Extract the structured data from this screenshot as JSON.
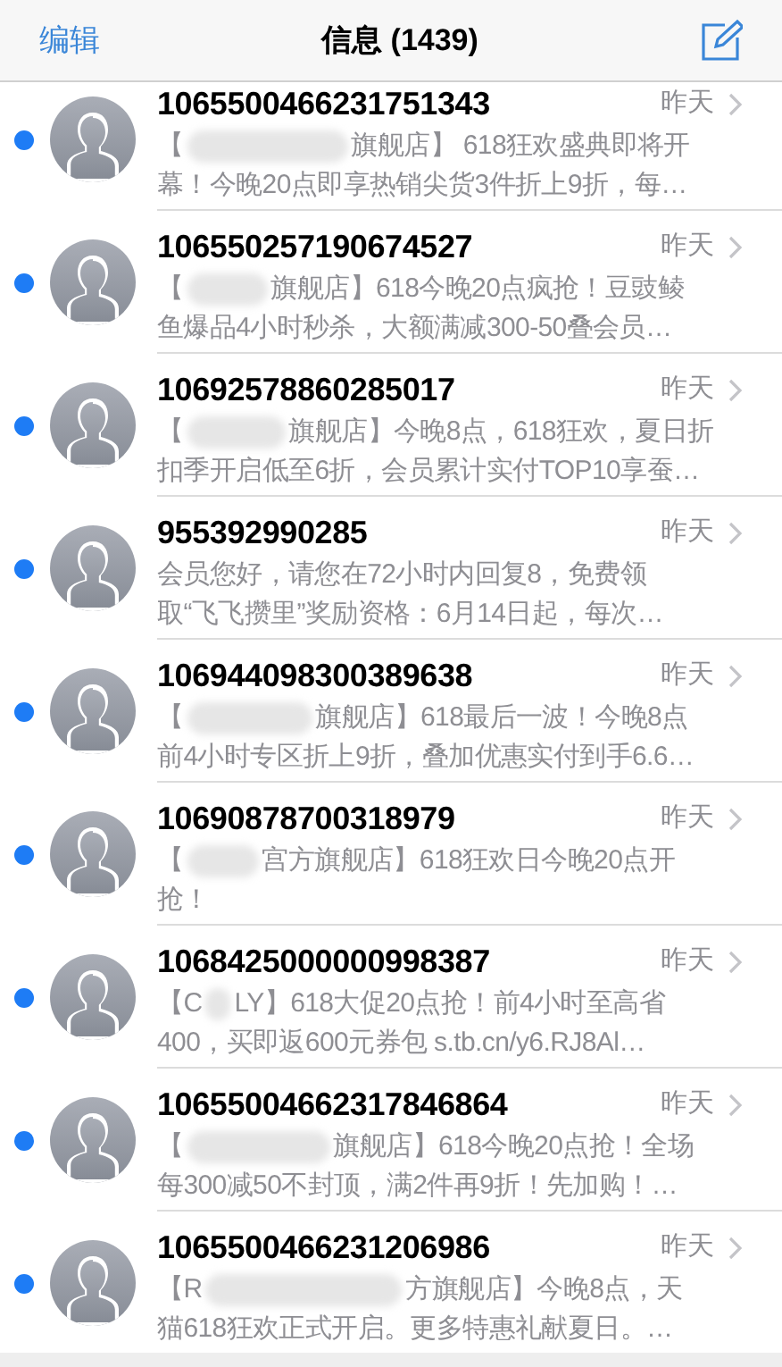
{
  "nav": {
    "edit": "编辑",
    "title": "信息 (1439)"
  },
  "messages": [
    {
      "sender": "1065500466231751343",
      "time": "昨天",
      "unread": true,
      "line1_before": "【",
      "line1_after": "旗舰店】 618狂欢盛典即将开",
      "line2": "幕！今晚20点即享热销尖货3件折上9折，每…"
    },
    {
      "sender": "106550257190674527",
      "time": "昨天",
      "unread": true,
      "line1_before": "【",
      "line1_after": "旗舰店】618今晚20点疯抢！豆豉鲮",
      "line2": "鱼爆品4小时秒杀，大额满减300-50叠会员…"
    },
    {
      "sender": "10692578860285017",
      "time": "昨天",
      "unread": true,
      "line1_before": "【",
      "line1_after": "旗舰店】今晚8点，618狂欢，夏日折",
      "line2": "扣季开启低至6折，会员累计实付TOP10享蚕…"
    },
    {
      "sender": "955392990285",
      "time": "昨天",
      "unread": true,
      "line1_before": "会员您好，请您在72小时内回复8，免费领",
      "line2": "取“飞飞攒里”奖励资格：6月14日起，每次…"
    },
    {
      "sender": "106944098300389638",
      "time": "昨天",
      "unread": true,
      "line1_before": "【",
      "line1_after": "旗舰店】618最后一波！今晚8点",
      "line2": "前4小时专区折上9折，叠加优惠实付到手6.6…"
    },
    {
      "sender": "10690878700318979",
      "time": "昨天",
      "unread": true,
      "line1_before": "【",
      "line1_after": "宫方旗舰店】618狂欢日今晚20点开",
      "line2": "抢！"
    },
    {
      "sender": "1068425000000998387",
      "time": "昨天",
      "unread": true,
      "line1_before": "【C",
      "line1_after": "LY】618大促20点抢！前4小时至高省",
      "line2": "400，买即返600元券包 s.tb.cn/y6.RJ8Al…"
    },
    {
      "sender": "10655004662317846864",
      "time": "昨天",
      "unread": true,
      "line1_before": "【",
      "line1_after": "旗舰店】618今晚20点抢！全场",
      "line2": "每300减50不封顶，满2件再9折！先加购！…"
    },
    {
      "sender": "1065500466231206986",
      "time": "昨天",
      "unread": true,
      "line1_before": "【R",
      "line1_after": "方旗舰店】今晚8点，天",
      "line2": "猫618狂欢正式开启。更多特惠礼献夏日。…"
    }
  ]
}
